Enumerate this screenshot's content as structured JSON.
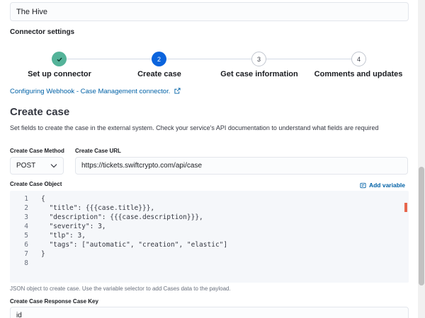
{
  "connector_name": "The Hive",
  "section_title": "Connector settings",
  "steps": [
    {
      "number": "",
      "label": "Set up connector",
      "status": "done"
    },
    {
      "number": "2",
      "label": "Create case",
      "status": "current"
    },
    {
      "number": "3",
      "label": "Get case information",
      "status": "todo"
    },
    {
      "number": "4",
      "label": "Comments and updates",
      "status": "todo"
    }
  ],
  "doc_link": "Configuring Webhook - Case Management connector.",
  "page_title": "Create case",
  "page_description": "Set fields to create the case in the external system. Check your service's API documentation to understand what fields are required",
  "method": {
    "label": "Create Case Method",
    "value": "POST"
  },
  "url": {
    "label": "Create Case URL",
    "value": "https://tickets.swiftcrypto.com/api/case"
  },
  "object": {
    "label": "Create Case Object",
    "add_variable": "Add variable",
    "lines": [
      {
        "n": "1",
        "text": "{"
      },
      {
        "n": "2",
        "text": "  \"title\": {{{case.title}}},"
      },
      {
        "n": "3",
        "text": "  \"description\": {{{case.description}}},"
      },
      {
        "n": "4",
        "text": "  \"severity\": 3,"
      },
      {
        "n": "5",
        "text": "  \"tlp\": 3,"
      },
      {
        "n": "6",
        "text": "  \"tags\": [\"automatic\", \"creation\", \"elastic\"]"
      },
      {
        "n": "7",
        "text": "}"
      },
      {
        "n": "8",
        "text": ""
      }
    ],
    "help": "JSON object to create case. Use the variable selector to add Cases data to the payload."
  },
  "response_key": {
    "label": "Create Case Response Case Key",
    "value": "id"
  },
  "colors": {
    "accent": "#0b64dd",
    "done": "#54b399",
    "link": "#0061a6"
  }
}
